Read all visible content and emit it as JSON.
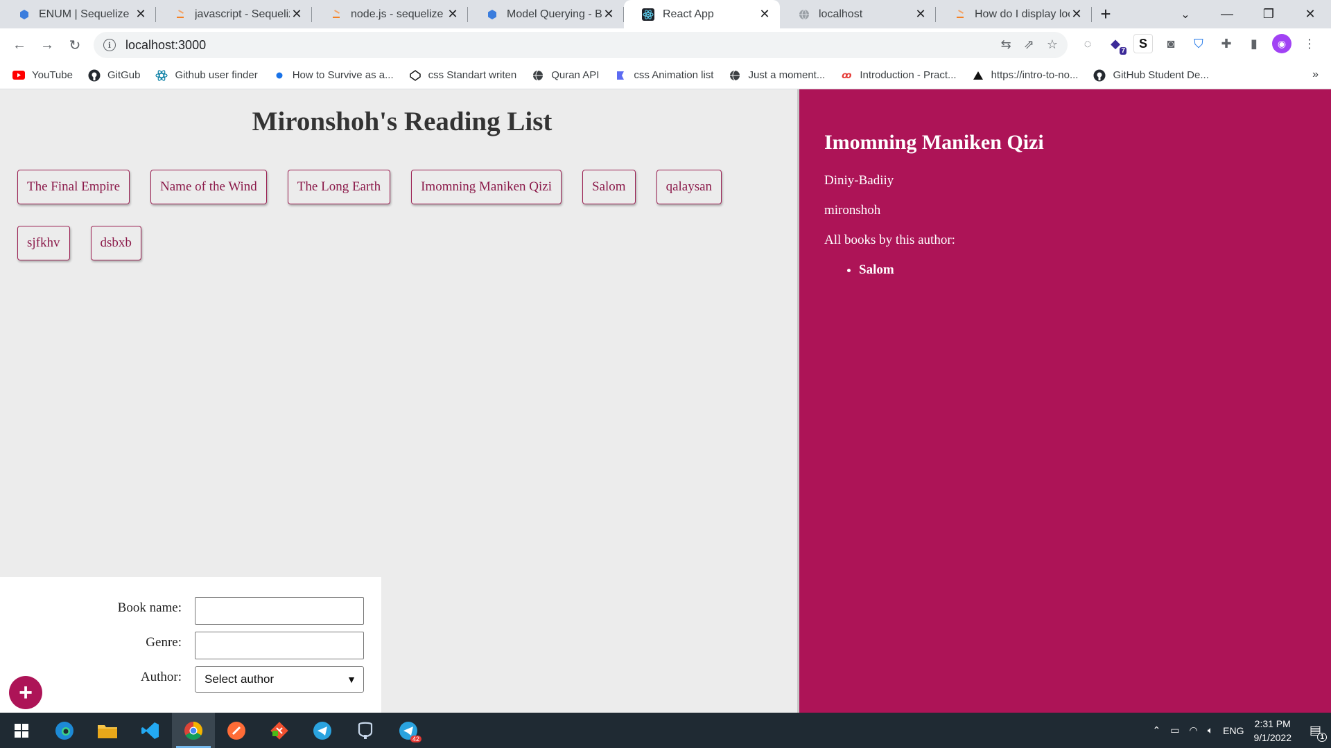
{
  "browser": {
    "tabs": [
      {
        "title": "ENUM | Sequelize",
        "icon": "sequelize-icon",
        "active": false
      },
      {
        "title": "javascript - Sequelize",
        "icon": "stackoverflow-icon",
        "active": false
      },
      {
        "title": "node.js - sequelize fin",
        "icon": "stackoverflow-icon",
        "active": false
      },
      {
        "title": "Model Querying - Bas",
        "icon": "sequelize-icon",
        "active": false
      },
      {
        "title": "React App",
        "icon": "react-icon",
        "active": true
      },
      {
        "title": "localhost",
        "icon": "globe-icon",
        "active": false
      },
      {
        "title": "How do I display loca",
        "icon": "stackoverflow-icon",
        "active": false
      }
    ],
    "url": "localhost:3000",
    "bookmarks": [
      {
        "label": "YouTube",
        "icon": "youtube-icon"
      },
      {
        "label": "GitGub",
        "icon": "github-icon"
      },
      {
        "label": "Github user finder",
        "icon": "react-icon"
      },
      {
        "label": "How to Survive as a...",
        "icon": "dot-icon"
      },
      {
        "label": "css Standart writen",
        "icon": "codepen-icon"
      },
      {
        "label": "Quran API",
        "icon": "globe-icon"
      },
      {
        "label": "css Animation list",
        "icon": "bookmark-icon"
      },
      {
        "label": "Just a moment...",
        "icon": "globe-icon"
      },
      {
        "label": "Introduction - Pract...",
        "icon": "gitbook-icon"
      },
      {
        "label": "https://intro-to-no...",
        "icon": "triangle-icon"
      },
      {
        "label": "GitHub Student De...",
        "icon": "github-icon"
      }
    ],
    "extension_badge": "7"
  },
  "page": {
    "title": "Mironshoh's Reading List",
    "books": [
      "The Final Empire",
      "Name of the Wind",
      "The Long Earth",
      "Imomning Maniken Qizi",
      "Salom",
      "qalaysan",
      "sjfkhv",
      "dsbxb"
    ],
    "form": {
      "book_name_label": "Book name:",
      "genre_label": "Genre:",
      "author_label": "Author:",
      "author_select_value": "Select author",
      "book_name_value": "",
      "genre_value": ""
    },
    "add_button_label": "+",
    "details": {
      "title": "Imomning Maniken Qizi",
      "genre": "Diniy-Badiiy",
      "author": "mironshoh",
      "all_books_label": "All books by this author:",
      "author_books": [
        "Salom"
      ]
    },
    "accent_color": "#ad1457",
    "background_color": "#ececec"
  },
  "taskbar": {
    "apps": [
      "windows-start-icon",
      "edge-icon",
      "file-explorer-icon",
      "vscode-icon",
      "chrome-icon",
      "postman-icon",
      "git-icon",
      "telegram-icon",
      "pgadmin-icon",
      "telegram-badge-icon"
    ],
    "telegram_badge": "42",
    "language": "ENG",
    "time": "2:31 PM",
    "date": "9/1/2022",
    "notification_count": "1"
  }
}
